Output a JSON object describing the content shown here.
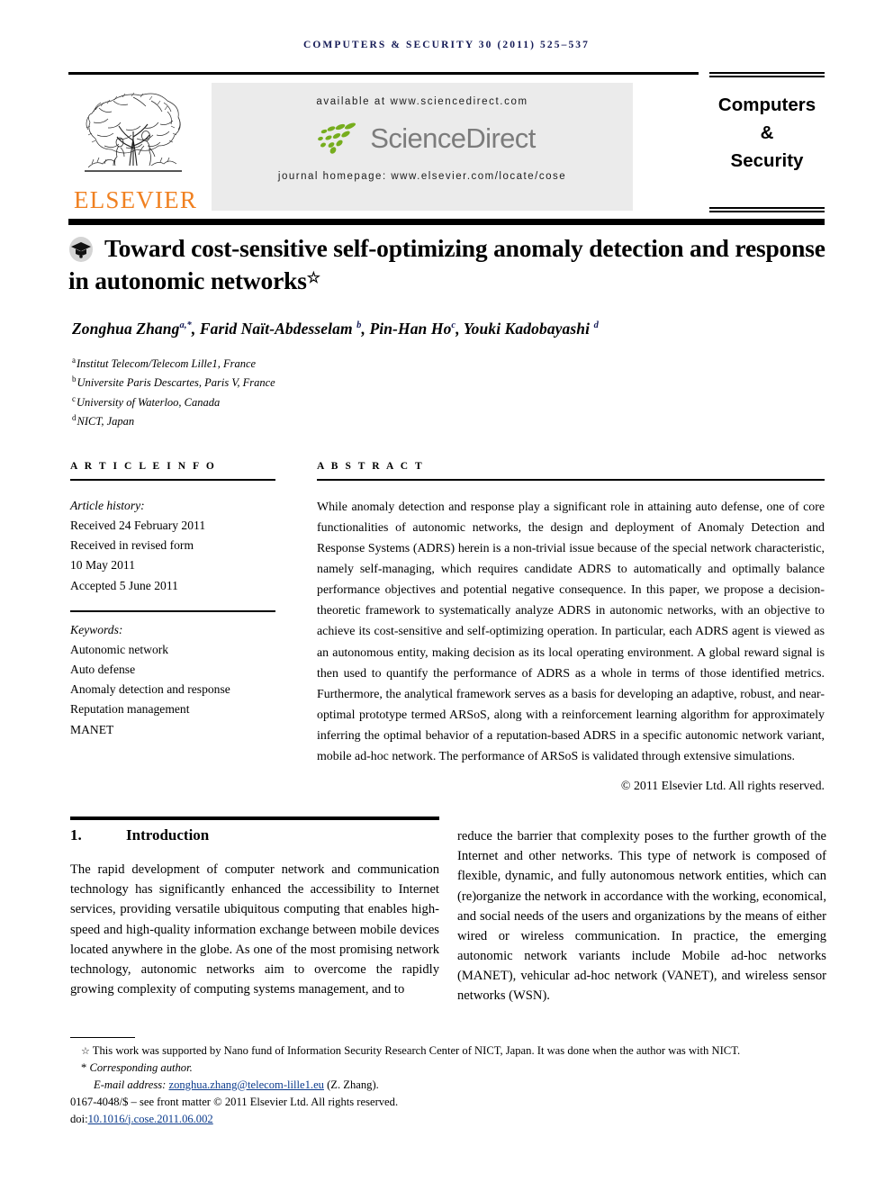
{
  "running_head": "COMPUTERS & SECURITY 30 (2011) 525–537",
  "masthead": {
    "publisher_word": "ELSEVIER",
    "publisher_logo_icon": "elsevier-tree-icon",
    "available_at": "available at www.sciencedirect.com",
    "sciencedirect_wordmark": "ScienceDirect",
    "sciencedirect_logo_icon": "sciencedirect-seeds-icon",
    "journal_homepage": "journal homepage: www.elsevier.com/locate/cose",
    "journal_title_line1": "Computers",
    "journal_title_line2": "&",
    "journal_title_line3": "Security"
  },
  "title": {
    "badge_icon": "graduation-cap-badge-icon",
    "text": "Toward cost-sensitive self-optimizing anomaly detection and response in autonomic networks",
    "footnote_marker": "☆"
  },
  "authors": {
    "list": [
      {
        "name": "Zonghua Zhang",
        "marks": "a,*"
      },
      {
        "name": "Farid Naït-Abdesselam",
        "marks": "b"
      },
      {
        "name": "Pin-Han Ho",
        "marks": "c"
      },
      {
        "name": "Youki Kadobayashi",
        "marks": "d"
      }
    ],
    "affiliations": [
      {
        "mark": "a",
        "text": "Institut Telecom/Telecom Lille1, France"
      },
      {
        "mark": "b",
        "text": "Universite Paris Descartes, Paris V, France"
      },
      {
        "mark": "c",
        "text": "University of Waterloo, Canada"
      },
      {
        "mark": "d",
        "text": "NICT, Japan"
      }
    ]
  },
  "article_info": {
    "heading": "A R T I C L E  I N F O",
    "history_label": "Article history:",
    "history": [
      "Received 24 February 2011",
      "Received in revised form",
      "10 May 2011",
      "Accepted 5 June 2011"
    ],
    "keywords_label": "Keywords:",
    "keywords": [
      "Autonomic network",
      "Auto defense",
      "Anomaly detection and response",
      "Reputation management",
      "MANET"
    ]
  },
  "abstract": {
    "heading": "A B S T R A C T",
    "text": "While anomaly detection and response play a significant role in attaining auto defense, one of core functionalities of autonomic networks, the design and deployment of Anomaly Detection and Response Systems (ADRS) herein is a non-trivial issue because of the special network characteristic, namely self-managing, which requires candidate ADRS to automatically and optimally balance performance objectives and potential negative consequence. In this paper, we propose a decision-theoretic framework to systematically analyze ADRS in autonomic networks, with an objective to achieve its cost-sensitive and self-optimizing operation. In particular, each ADRS agent is viewed as an autonomous entity, making decision as its local operating environment. A global reward signal is then used to quantify the performance of ADRS as a whole in terms of those identified metrics. Furthermore, the analytical framework serves as a basis for developing an adaptive, robust, and near-optimal prototype termed ARSoS, along with a reinforcement learning algorithm for approximately inferring the optimal behavior of a reputation-based ADRS in a specific autonomic network variant, mobile ad-hoc network. The performance of ARSoS is validated through extensive simulations.",
    "copyright": "© 2011 Elsevier Ltd. All rights reserved."
  },
  "introduction": {
    "number": "1.",
    "heading": "Introduction",
    "column_left": "The rapid development of computer network and communication technology has significantly enhanced the accessibility to Internet services, providing versatile ubiquitous computing that enables high-speed and high-quality information exchange between mobile devices located anywhere in the globe. As one of the most promising network technology, autonomic networks aim to overcome the rapidly growing complexity of computing systems management, and to",
    "column_right": "reduce the barrier that complexity poses to the further growth of the Internet and other networks. This type of network is composed of flexible, dynamic, and fully autonomous network entities, which can (re)organize the network in accordance with the working, economical, and social needs of the users and organizations by the means of either wired or wireless communication. In practice, the emerging autonomic network variants include Mobile ad-hoc networks (MANET), vehicular ad-hoc network (VANET), and wireless sensor networks (WSN)."
  },
  "footnotes": {
    "funding_marker": "☆",
    "funding": "This work was supported by Nano fund of Information Security Research Center of NICT, Japan. It was done when the author was with NICT.",
    "corresponding_marker": "*",
    "corresponding": "Corresponding author.",
    "email_label": "E-mail address:",
    "email": "zonghua.zhang@telecom-lille1.eu",
    "email_suffix": "(Z. Zhang).",
    "issn_line": "0167-4048/$ – see front matter © 2011 Elsevier Ltd. All rights reserved.",
    "doi_label": "doi:",
    "doi": "10.1016/j.cose.2011.06.002"
  },
  "colors": {
    "running_head": "#141a56",
    "elsevier_orange": "#f08020",
    "sciencedirect_green": "#76ad1d",
    "sciencedirect_gray": "#7c7c7c",
    "link_blue": "#0a3a8c",
    "banner_bg": "#ebebeb"
  }
}
